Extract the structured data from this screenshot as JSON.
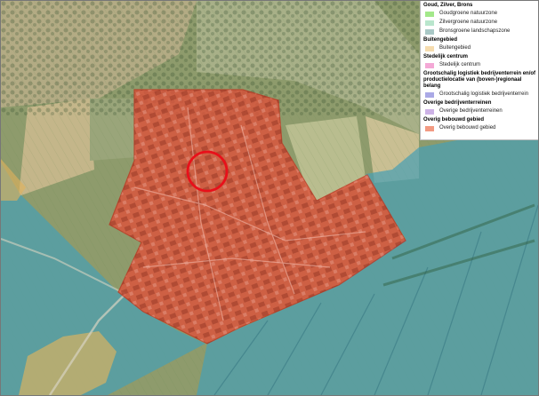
{
  "legend": {
    "groups": [
      {
        "header": "Goud, Zilver, Brons",
        "items": [
          {
            "label": "Goudgroene natuurzone",
            "color": "#a3e88a"
          },
          {
            "label": "Zilvergroene natuurzone",
            "color": "#b9e6cd"
          },
          {
            "label": "Bronsgroene landschapszone",
            "color": "#a9c8c6"
          }
        ]
      },
      {
        "header": "Buitengebied",
        "items": [
          {
            "label": "Buitengebied",
            "color": "#f6dcae"
          }
        ]
      },
      {
        "header": "Stedelijk centrum",
        "items": [
          {
            "label": "Stedelijk centrum",
            "color": "#f4a8d6"
          }
        ]
      },
      {
        "header": "Grootschalig logistiek bedrijventerrein en/of productielocatie van (boven-)regionaal belang",
        "items": [
          {
            "label": "Grootschalig logistiek bedrijventerrein",
            "color": "#aaa9e6"
          }
        ]
      },
      {
        "header": "Overige bedrijventerreinen",
        "items": [
          {
            "label": "Overige bedrijventerreinen",
            "color": "#cdb2e6"
          }
        ]
      },
      {
        "header": "Overig bebouwd gebied",
        "items": [
          {
            "label": "Overig bebouwd gebied",
            "color": "#f29a82"
          }
        ]
      }
    ]
  },
  "colors": {
    "built_area": "#e0503a",
    "built_area_stroke": "#c0331f",
    "landscape_zone": "#4a9fb3",
    "rural_area": "#e2b35c",
    "marker": "#e8101a"
  }
}
